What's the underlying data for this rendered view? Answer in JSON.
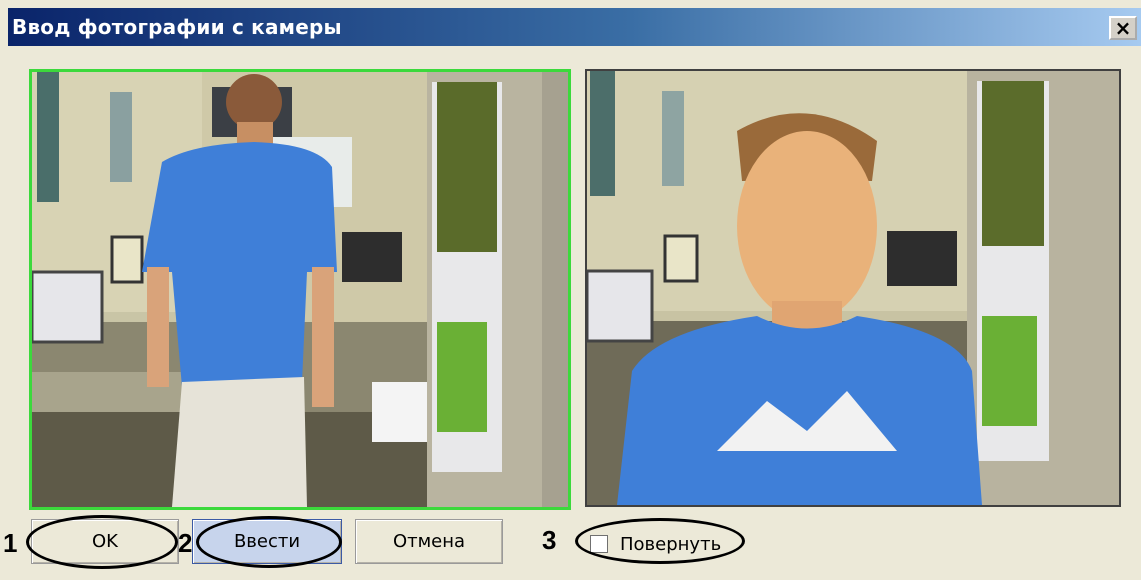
{
  "dialog": {
    "title": "Ввод фотографии с камеры",
    "close_glyph": "×"
  },
  "photos": {
    "live_view": {
      "icon": "camera-live-feed-image"
    },
    "captured": {
      "icon": "captured-photo-image"
    }
  },
  "buttons": {
    "ok_label": "OK",
    "enter_label": "Ввести",
    "cancel_label": "Отмена"
  },
  "rotate": {
    "label": "Повернуть",
    "checked": false
  },
  "callouts": [
    "1",
    "2",
    "3"
  ],
  "colors": {
    "title_gradient_start": "#0a246a",
    "title_gradient_end": "#a6caf0",
    "live_view_border": "#3cd93c",
    "selected_button": "#c7d4ec",
    "dialog_background": "#ece9d8"
  }
}
